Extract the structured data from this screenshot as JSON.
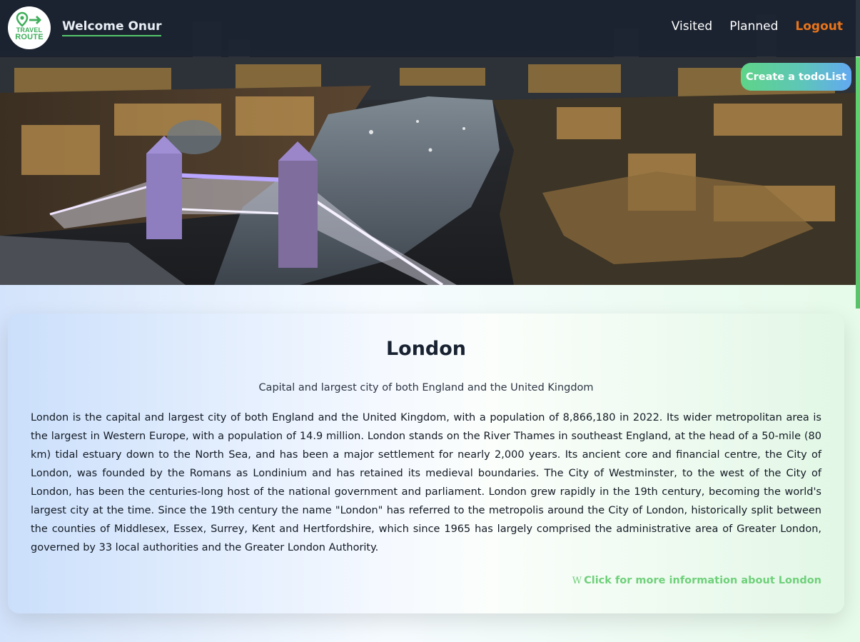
{
  "brand": {
    "logo_line1": "TRAVEL",
    "logo_line2": "ROUTE"
  },
  "header": {
    "welcome_prefix": "Welcome",
    "user_name": "Onur"
  },
  "nav": {
    "visited": "Visited",
    "planned": "Planned",
    "logout": "Logout"
  },
  "actions": {
    "create_todo": "Create a todoList"
  },
  "city": {
    "name": "London",
    "subtitle": "Capital and largest city of both England and the United Kingdom",
    "description": "London is the capital and largest city of both England and the United Kingdom, with a population of 8,866,180 in 2022. Its wider metropolitan area is the largest in Western Europe, with a population of 14.9 million. London stands on the River Thames in southeast England, at the head of a 50-mile (80 km) tidal estuary down to the North Sea, and has been a major settlement for nearly 2,000 years. Its ancient core and financial centre, the City of London, was founded by the Romans as Londinium and has retained its medieval boundaries. The City of Westminster, to the west of the City of London, has been the centuries-long host of the national government and parliament. London grew rapidly in the 19th century, becoming the world's largest city at the time. Since the 19th century the name \"London\" has referred to the metropolis around the City of London, historically split between the counties of Middlesex, Essex, Surrey, Kent and Hertfordshire, which since 1965 has largely comprised the administrative area of Greater London, governed by 33 local authorities and the Greater London Authority.",
    "more_info_icon": "W",
    "more_info_label": "Click for more information about London"
  },
  "colors": {
    "accent_green": "#56c66c",
    "logout_orange": "#e9741a",
    "link_green": "#6fd07a",
    "navbar_bg": "#1c2432"
  },
  "icons": {
    "logo": "travel-route-pin-arrow-icon",
    "wiki": "wikipedia-icon"
  }
}
